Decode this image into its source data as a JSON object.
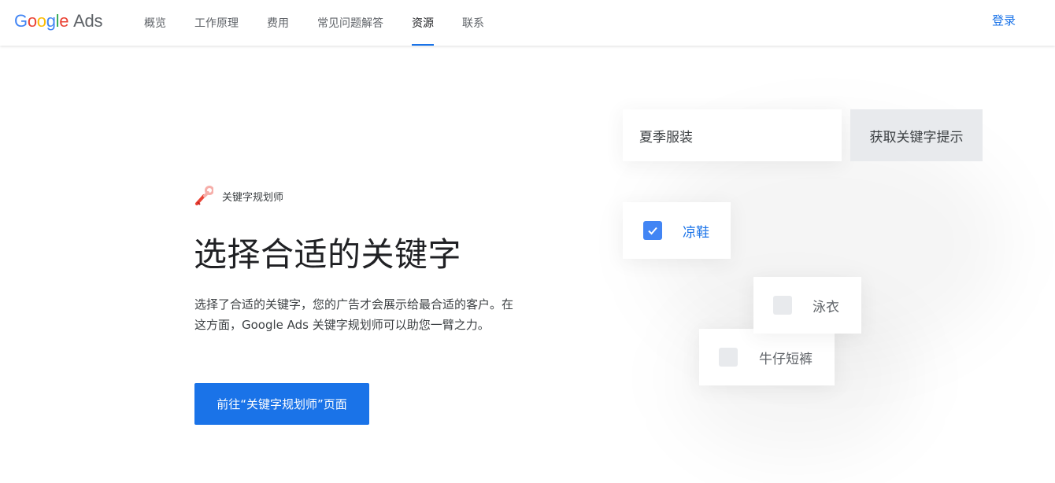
{
  "header": {
    "logo": {
      "g1": "G",
      "g2": "o",
      "g3": "o",
      "g4": "g",
      "g5": "l",
      "g6": "e",
      "ads": "Ads"
    },
    "nav": [
      "概览",
      "工作原理",
      "费用",
      "常见问题解答",
      "资源",
      "联系"
    ],
    "active_nav": "资源",
    "login_label": "登录"
  },
  "hero": {
    "eyebrow_icon": "wrench-icon",
    "eyebrow": "关键字规划师",
    "headline": "选择合适的关键字",
    "description": "选择了合适的关键字，您的广告才会展示给最合适的客户。在这方面，Google Ads 关键字规划师可以助您一臂之力。",
    "cta_label": "前往“关键字规划师”页面"
  },
  "illustration": {
    "search_value": "夏季服装",
    "search_button_label": "获取关键字提示",
    "keywords": [
      {
        "label": "凉鞋",
        "checked": true
      },
      {
        "label": "泳衣",
        "checked": false
      },
      {
        "label": "牛仔短裤",
        "checked": false
      }
    ]
  },
  "colors": {
    "accent": "#1a73e8",
    "checkbox_checked": "#4285f4",
    "wrench": "#ea4335"
  }
}
